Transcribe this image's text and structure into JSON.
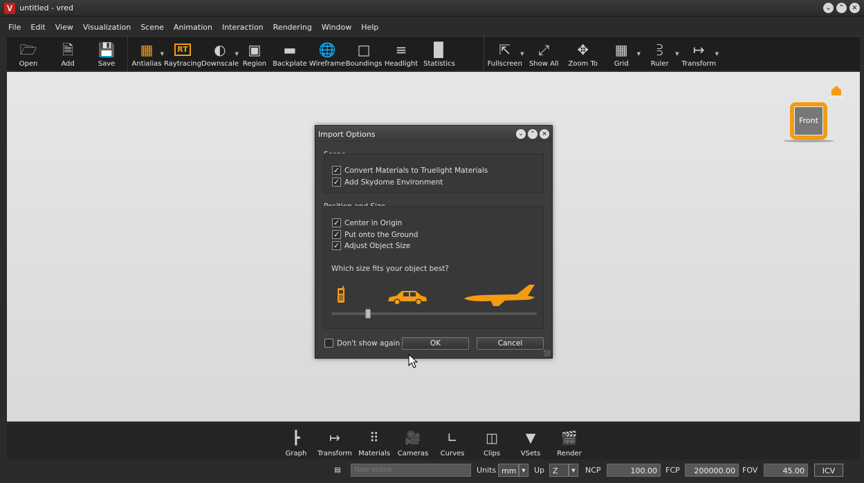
{
  "window": {
    "title": "untitled - vred",
    "app_icon": "V"
  },
  "menu": [
    "File",
    "Edit",
    "View",
    "Visualization",
    "Scene",
    "Animation",
    "Interaction",
    "Rendering",
    "Window",
    "Help"
  ],
  "toolbar": {
    "open": {
      "label": "Open",
      "icon": "folder-icon"
    },
    "add": {
      "label": "Add",
      "icon": "add-file-icon"
    },
    "save": {
      "label": "Save",
      "icon": "save-icon"
    },
    "antialias": {
      "label": "Antialias",
      "icon": "antialias-icon"
    },
    "raytracing": {
      "label": "Raytracing",
      "icon_text": "RT"
    },
    "downscale": {
      "label": "Downscale",
      "icon": "downscale-icon"
    },
    "region": {
      "label": "Region",
      "icon": "region-icon"
    },
    "backplate": {
      "label": "Backplate",
      "icon": "backplate-icon"
    },
    "wireframe": {
      "label": "Wireframe",
      "icon": "wireframe-icon"
    },
    "boundings": {
      "label": "Boundings",
      "icon": "boundings-icon"
    },
    "headlight": {
      "label": "Headlight",
      "icon": "headlight-icon"
    },
    "statistics": {
      "label": "Statistics",
      "icon": "statistics-icon"
    },
    "fullscreen": {
      "label": "Fullscreen",
      "icon": "fullscreen-icon"
    },
    "show_all": {
      "label": "Show All",
      "icon": "show-all-icon"
    },
    "zoom_to": {
      "label": "Zoom To",
      "icon": "zoom-to-icon"
    },
    "grid": {
      "label": "Grid",
      "icon": "grid-icon"
    },
    "ruler": {
      "label": "Ruler",
      "icon": "ruler-icon"
    },
    "transform": {
      "label": "Transform",
      "icon": "transform-icon"
    }
  },
  "viewport": {
    "home_label": "HOME",
    "navcube_face": "Front"
  },
  "dialog": {
    "title": "Import Options",
    "scene_group": "Scene",
    "scene_options": [
      {
        "label": "Convert Materials to Truelight Materials",
        "checked": true
      },
      {
        "label": "Add Skydome Environment",
        "checked": true
      }
    ],
    "position_group": "Position and Size",
    "position_options": [
      {
        "label": "Center in Origin",
        "checked": true
      },
      {
        "label": "Put onto the Ground",
        "checked": true
      },
      {
        "label": "Adjust Object Size",
        "checked": true
      }
    ],
    "size_question": "Which size fits your object best?",
    "size_slider_value": 0.17,
    "dont_show_again": {
      "label": "Don't show again",
      "checked": false
    },
    "ok_label": "OK",
    "cancel_label": "Cancel"
  },
  "bottom_tools": [
    {
      "label": "Graph",
      "icon": "graph-icon"
    },
    {
      "label": "Transform",
      "icon": "transform-icon"
    },
    {
      "label": "Materials",
      "icon": "materials-icon"
    },
    {
      "label": "Cameras",
      "icon": "cameras-icon"
    },
    {
      "label": "Curves",
      "icon": "curves-icon"
    },
    {
      "label": "Clips",
      "icon": "clips-icon"
    },
    {
      "label": "VSets",
      "icon": "vsets-icon"
    },
    {
      "label": "Render",
      "icon": "render-icon"
    }
  ],
  "statusbar": {
    "scene_name_placeholder": "New scene.",
    "units_label": "Units",
    "units_value": "mm",
    "up_label": "Up",
    "up_value": "Z",
    "ncp_label": "NCP",
    "ncp_value": "100.00",
    "fcp_label": "FCP",
    "fcp_value": "200000.00",
    "fov_label": "FOV",
    "fov_value": "45.00",
    "icv_label": "ICV"
  },
  "colors": {
    "accent": "#f39c12",
    "viewport_bg": "#e0e0e0",
    "app_red": "#c0201f"
  }
}
